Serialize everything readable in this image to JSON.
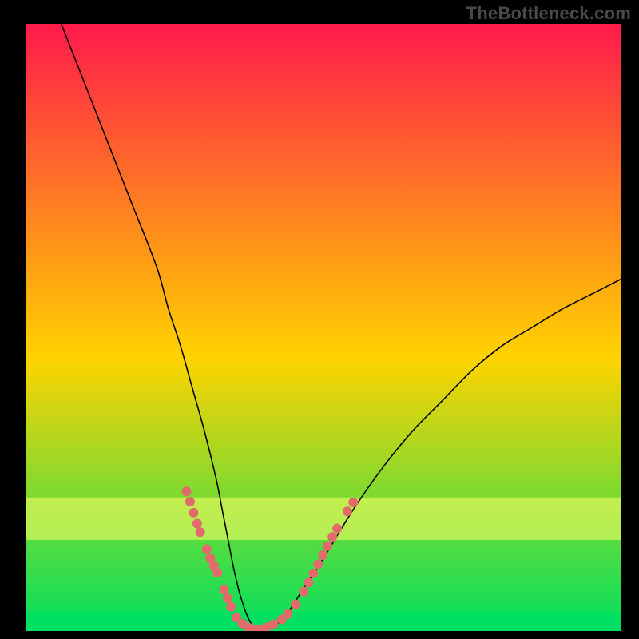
{
  "watermark": "TheBottleneck.com",
  "chart_data": {
    "type": "line",
    "title": "",
    "xlabel": "",
    "ylabel": "",
    "xlim": [
      0,
      100
    ],
    "ylim": [
      0,
      100
    ],
    "grid": false,
    "legend": "none",
    "background_gradient_top": "#ff1a4a",
    "background_gradient_mid": "#ffd300",
    "background_gradient_bottom": "#00e060",
    "series": [
      {
        "name": "bottleneck-curve",
        "color": "#000000",
        "x": [
          6,
          10,
          14,
          18,
          22,
          24,
          26,
          28,
          30,
          32,
          33,
          34,
          35,
          36,
          37,
          38,
          39,
          40,
          42,
          44,
          46,
          50,
          55,
          60,
          65,
          70,
          75,
          80,
          85,
          90,
          95,
          100
        ],
        "y": [
          100,
          90,
          80,
          70,
          60,
          53,
          47,
          40,
          33,
          25,
          20,
          15,
          10,
          6,
          3,
          1,
          0,
          0,
          1,
          3,
          6,
          12,
          20,
          27,
          33,
          38,
          43,
          47,
          50,
          53,
          55.5,
          58
        ]
      }
    ],
    "highlight_bars": [
      {
        "name": "upper-yellow-band",
        "y_top": 22,
        "y_bottom": 15,
        "color": "#ffff66",
        "opacity": 0.55
      },
      {
        "name": "lower-green-band",
        "y_top": 3.2,
        "y_bottom": 0,
        "color": "#00e060",
        "opacity": 1.0
      }
    ],
    "markers": {
      "name": "curve-dots",
      "color": "#e26a6a",
      "radius": 6,
      "points": [
        {
          "x": 27.0,
          "y": 23.0
        },
        {
          "x": 27.6,
          "y": 21.3
        },
        {
          "x": 28.2,
          "y": 19.5
        },
        {
          "x": 28.8,
          "y": 17.7
        },
        {
          "x": 29.3,
          "y": 16.3
        },
        {
          "x": 30.4,
          "y": 13.5
        },
        {
          "x": 31.0,
          "y": 12.0
        },
        {
          "x": 31.6,
          "y": 10.8
        },
        {
          "x": 32.2,
          "y": 9.6
        },
        {
          "x": 33.3,
          "y": 6.8
        },
        {
          "x": 33.9,
          "y": 5.4
        },
        {
          "x": 34.5,
          "y": 4.0
        },
        {
          "x": 35.4,
          "y": 2.2
        },
        {
          "x": 36.4,
          "y": 1.2
        },
        {
          "x": 37.4,
          "y": 0.6
        },
        {
          "x": 38.4,
          "y": 0.3
        },
        {
          "x": 39.4,
          "y": 0.3
        },
        {
          "x": 40.4,
          "y": 0.6
        },
        {
          "x": 41.6,
          "y": 1.1
        },
        {
          "x": 43.0,
          "y": 1.9
        },
        {
          "x": 44.0,
          "y": 2.8
        },
        {
          "x": 45.3,
          "y": 4.4
        },
        {
          "x": 46.7,
          "y": 6.5
        },
        {
          "x": 47.5,
          "y": 8.0
        },
        {
          "x": 48.3,
          "y": 9.5
        },
        {
          "x": 49.1,
          "y": 11.0
        },
        {
          "x": 49.9,
          "y": 12.5
        },
        {
          "x": 50.7,
          "y": 14.0
        },
        {
          "x": 51.5,
          "y": 15.5
        },
        {
          "x": 52.3,
          "y": 16.9
        },
        {
          "x": 54.0,
          "y": 19.7
        },
        {
          "x": 55.0,
          "y": 21.2
        }
      ]
    }
  }
}
